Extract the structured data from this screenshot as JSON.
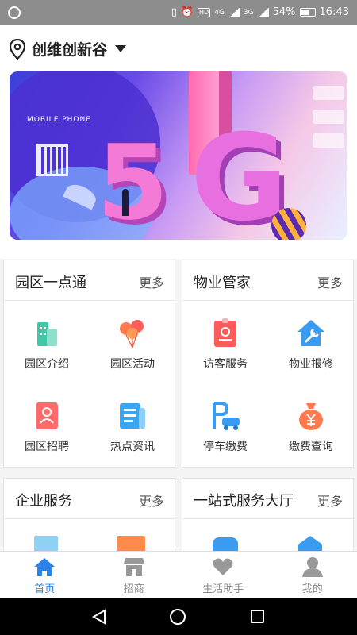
{
  "status_bar": {
    "hd": "HD",
    "net1": "4G",
    "net2": "3G",
    "battery": "54%",
    "time": "16:43"
  },
  "header": {
    "location": "创维创新谷"
  },
  "banner": {
    "text": "MOBILE PHONE"
  },
  "cards": [
    {
      "title": "园区一点通",
      "more": "更多",
      "items": [
        {
          "label": "园区介绍",
          "icon": "building-icon"
        },
        {
          "label": "园区活动",
          "icon": "balloons-icon"
        },
        {
          "label": "园区招聘",
          "icon": "recruit-icon"
        },
        {
          "label": "热点资讯",
          "icon": "news-icon"
        }
      ]
    },
    {
      "title": "物业管家",
      "more": "更多",
      "items": [
        {
          "label": "访客服务",
          "icon": "visitor-icon"
        },
        {
          "label": "物业报修",
          "icon": "repair-icon"
        },
        {
          "label": "停车缴费",
          "icon": "parking-icon"
        },
        {
          "label": "缴费查询",
          "icon": "money-bag-icon"
        }
      ]
    },
    {
      "title": "企业服务",
      "more": "更多"
    },
    {
      "title": "一站式服务大厅",
      "more": "更多"
    }
  ],
  "tabs": [
    {
      "label": "首页",
      "icon": "home-icon",
      "active": true
    },
    {
      "label": "招商",
      "icon": "store-icon"
    },
    {
      "label": "生活助手",
      "icon": "heart-icon"
    },
    {
      "label": "我的",
      "icon": "user-icon"
    }
  ],
  "colors": {
    "accent": "#2a84e8",
    "text": "#222222"
  }
}
